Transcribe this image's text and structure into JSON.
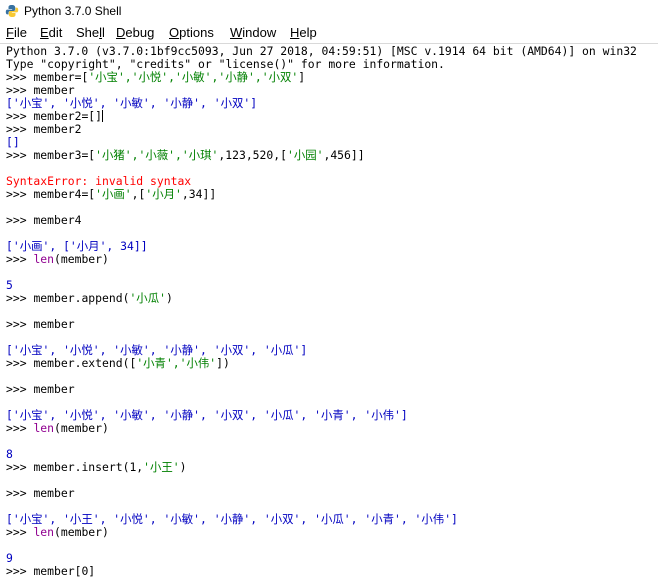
{
  "window": {
    "title": "Python 3.7.0 Shell"
  },
  "menu": {
    "items": [
      {
        "ul": "F",
        "rest": "ile"
      },
      {
        "ul": "E",
        "rest": "dit"
      },
      {
        "ul": "",
        "pre": "She",
        "ul2": "l",
        "rest": "l"
      },
      {
        "ul": "D",
        "rest": "ebug"
      },
      {
        "ul": "O",
        "rest": "ptions"
      },
      {
        "ul": "W",
        "rest": "indow"
      },
      {
        "ul": "H",
        "rest": "elp"
      }
    ]
  },
  "shell": {
    "banner1": "Python 3.7.0 (v3.7.0:1bf9cc5093, Jun 27 2018, 04:59:51) [MSC v.1914 64 bit (AMD64)] on win32",
    "banner2": "Type \"copyright\", \"credits\" or \"license()\" for more information.",
    "prompt": ">>> ",
    "l1_cmd": "member=[",
    "l1_str": "'小宝','小悦','小敏','小静','小双'",
    "l1_end": "]",
    "l2_cmd": "member",
    "l3_out": "['小宝', '小悦', '小敏', '小静', '小双']",
    "l4_cmd": "member2=[]",
    "l5_cmd": "member2",
    "l6_out": "[]",
    "l7_cmd": "member3=[",
    "l7_str": "'小猪','小薇','小琪'",
    "l7_end": ",123,520,[",
    "l7_str2": "'小园'",
    "l7_end2": ",456]]",
    "l8_err": "SyntaxError: invalid syntax",
    "l9_cmd": "member4=[",
    "l9_str": "'小画'",
    "l9_mid": ",[",
    "l9_str2": "'小月'",
    "l9_end": ",34]]",
    "l10_cmd": "member4",
    "l11_out": "['小画', ['小月', 34]]",
    "l12_builtin": "len",
    "l12_rest": "(member)",
    "l13_out": "5",
    "l14_cmd": "member.append(",
    "l14_str": "'小瓜'",
    "l14_end": ")",
    "l15_cmd": "member",
    "l16_out": "['小宝', '小悦', '小敏', '小静', '小双', '小瓜']",
    "l17_cmd": "member.extend([",
    "l17_str": "'小青','小伟'",
    "l17_end": "])",
    "l18_cmd": "member",
    "l19_out": "['小宝', '小悦', '小敏', '小静', '小双', '小瓜', '小青', '小伟']",
    "l20_builtin": "len",
    "l20_rest": "(member)",
    "l21_out": "8",
    "l22_cmd": "member.insert(1,",
    "l22_str": "'小王'",
    "l22_end": ")",
    "l23_cmd": "member",
    "l24_out": "['小宝', '小王', '小悦', '小敏', '小静', '小双', '小瓜', '小青', '小伟']",
    "l25_builtin": "len",
    "l25_rest": "(member)",
    "l26_out": "9",
    "l27_cmd": "member[0]"
  }
}
